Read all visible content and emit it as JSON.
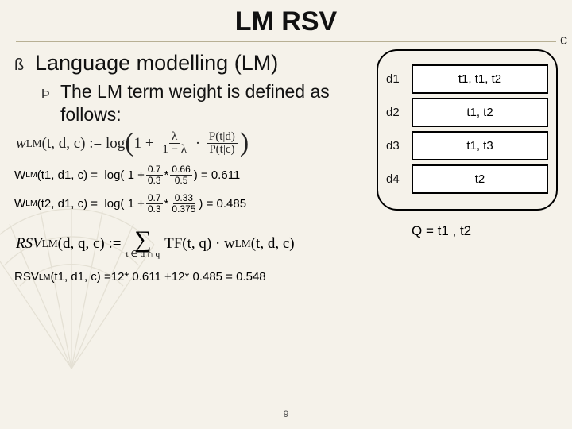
{
  "title": "LM RSV",
  "heading": "Language modelling (LM)",
  "sub": "The LM term weight is defined as follows:",
  "formula_wlm": {
    "lhs": "w",
    "lhs_sub": "LM",
    "args": "(t, d, c) := log",
    "frac1_num": "λ",
    "frac1_den": "1 − λ",
    "frac2_num": "P(t|d)",
    "frac2_den": "P(t|c)",
    "open": "(1 +",
    "dot": "·",
    "close": ")"
  },
  "calc1": {
    "prefix": "W",
    "prefix_sub": "LM",
    "args": "(t1, d1, c) = ",
    "log": "log( 1 +",
    "a_num": "0.7",
    "a_den": "0.3",
    "star1": " * ",
    "b_num": "0.66",
    "b_den": "0.5",
    "tail": " ) = 0.611"
  },
  "calc2": {
    "prefix": "W",
    "prefix_sub": "LM",
    "args": "(t2, d1, c) = ",
    "log": "log( 1 +",
    "a_num": "0.7",
    "a_den": "0.3",
    "star1": " * ",
    "b_num": "0.33",
    "b_den": "0.375",
    "tail": " ) = 0.485"
  },
  "rsv_def": {
    "lhs": "RSV",
    "lhs_sub": "LM",
    "args": "(d, q, c) :=",
    "sigma_sub": "t ∈ d ∩ q",
    "rhs1": "TF(t, q) · w",
    "rhs1_sub": "LM",
    "rhs2": "(t, d, c)"
  },
  "rsv_calc": {
    "prefix": "RSV",
    "prefix_sub": "LM",
    "args": "(t1, d1, c) = ",
    "a_num": "1",
    "a_den": "2",
    "mid1": " * 0.611 + ",
    "b_num": "1",
    "b_den": "2",
    "tail": " * 0.485 = 0.548"
  },
  "c_label": "c",
  "docs": [
    {
      "label": "d1",
      "content": "t1, t1, t2"
    },
    {
      "label": "d2",
      "content": "t1, t2"
    },
    {
      "label": "d3",
      "content": "t1, t3"
    },
    {
      "label": "d4",
      "content": "t2"
    }
  ],
  "query": "Q = t1 , t2",
  "page": "9"
}
